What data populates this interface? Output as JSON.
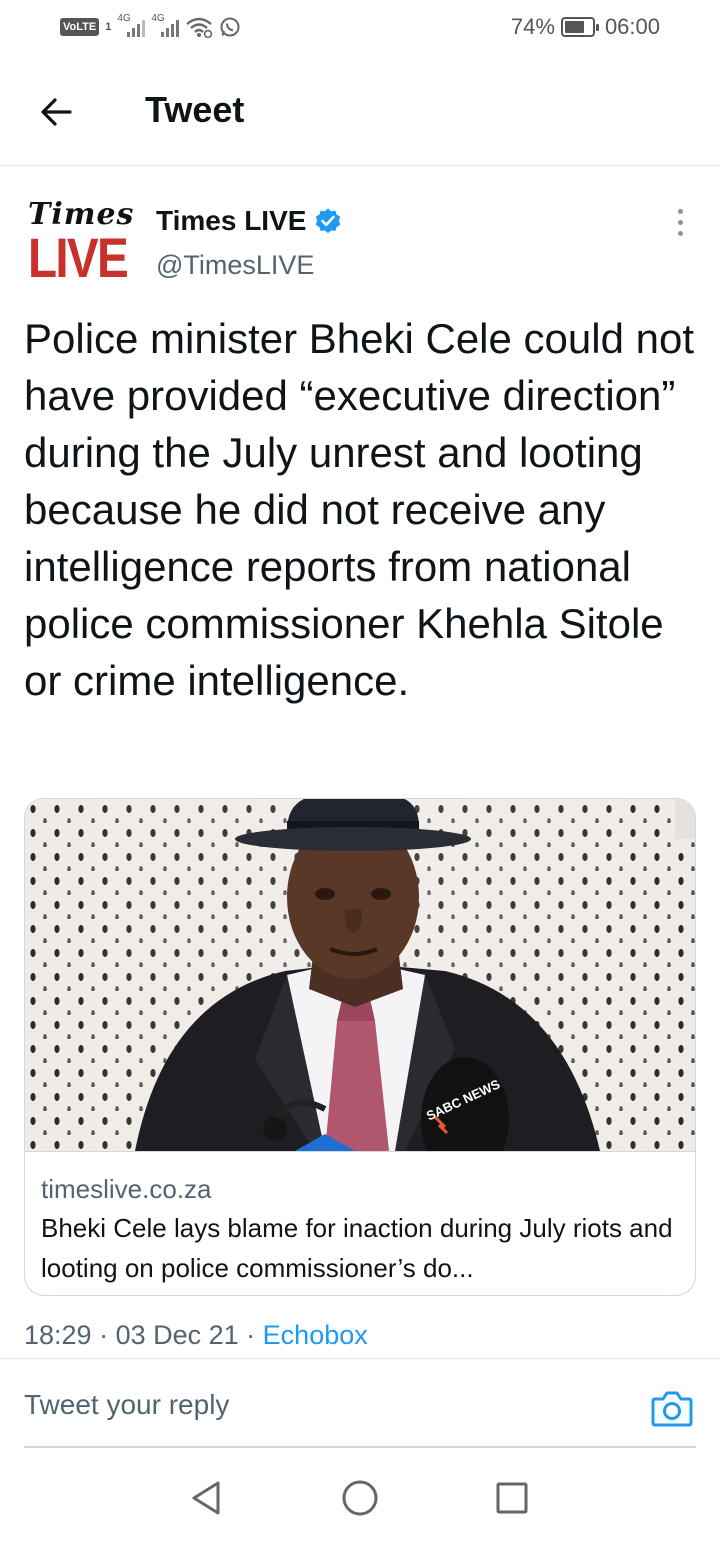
{
  "status_bar": {
    "volte": "VoLTE",
    "sim": "1",
    "net1": "4G",
    "net2": "4G",
    "battery_percent": "74%",
    "battery_level": 0.74,
    "time": "06:00",
    "icons": [
      "volte-icon",
      "signal-icon",
      "signal-icon",
      "wifi-icon",
      "whatsapp-icon",
      "battery-icon"
    ]
  },
  "header": {
    "back_icon": "arrow-left-icon",
    "title": "Tweet"
  },
  "author": {
    "logo_line1": "Times",
    "logo_line2": "LIVE",
    "name": "Times LIVE",
    "verified_icon": "verified-badge-icon",
    "handle": "@TimesLIVE",
    "more_icon": "more-vertical-icon"
  },
  "tweet": {
    "text": "Police minister Bheki Cele could not have provided “executive direction” during the July unrest and looting because he did not receive any intelligence reports from national police commissioner Khehla Sitole or crime intelligence."
  },
  "card": {
    "mic_label": "SABC NEWS",
    "domain": "timeslive.co.za",
    "title": "Bheki Cele lays blame for inaction during July riots and looting on police commissioner’s do..."
  },
  "meta": {
    "time": "18:29",
    "separator1": " · ",
    "date": "03 Dec 21",
    "separator2": " · ",
    "source": "Echobox"
  },
  "reply": {
    "placeholder": "Tweet your reply",
    "camera_icon": "camera-icon"
  },
  "nav": {
    "icons": [
      "back-triangle-icon",
      "home-circle-icon",
      "recents-square-icon"
    ]
  },
  "colors": {
    "accent": "#1d9bf0",
    "brand_red": "#c8302b",
    "text": "#0f1419",
    "muted": "#536471"
  }
}
